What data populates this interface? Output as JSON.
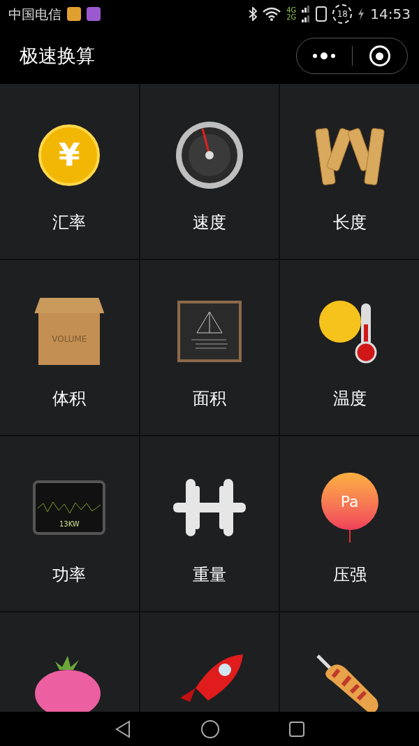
{
  "status_bar": {
    "carrier": "中国电信",
    "network_top": "4G",
    "network_bottom": "2G",
    "battery": "18",
    "time": "14:53"
  },
  "header": {
    "title": "极速换算"
  },
  "tiles": [
    {
      "label": "汇率",
      "icon_text": "¥"
    },
    {
      "label": "速度"
    },
    {
      "label": "长度"
    },
    {
      "label": "体积",
      "icon_text": "VOLUME"
    },
    {
      "label": "面积"
    },
    {
      "label": "温度"
    },
    {
      "label": "功率",
      "icon_text": "13KW"
    },
    {
      "label": "重量"
    },
    {
      "label": "压强",
      "icon_text": "Pa"
    }
  ]
}
